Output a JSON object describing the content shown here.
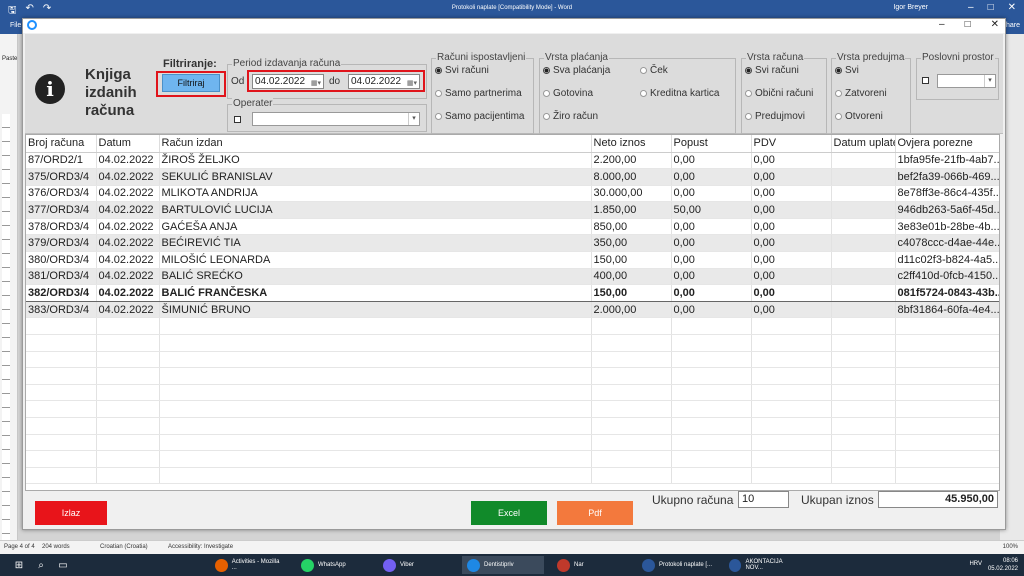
{
  "word": {
    "title": "Protokoli naplate [Compatibility Mode] - Word",
    "user": "Igor Breyer",
    "file_tab": "File",
    "share": "Share",
    "paste": "Paste",
    "status": {
      "page": "Page 4 of 4",
      "words": "204 words",
      "language": "Croatian (Croatia)",
      "accessibility": "Accessibility: Investigate",
      "zoom": "100%"
    }
  },
  "taskbar": {
    "apps": [
      {
        "label": "Activities - Mozilla ...",
        "color": "#e66000"
      },
      {
        "label": "WhatsApp",
        "color": "#25d366"
      },
      {
        "label": "Viber",
        "color": "#7360f2"
      },
      {
        "label": "Dentistipriv",
        "color": "#1e88e5"
      },
      {
        "label": "Nar",
        "color": "#c0392b"
      },
      {
        "label": "Protokoli naplate [...",
        "color": "#2b579a"
      },
      {
        "label": "AKONTACIJA NOV...",
        "color": "#2b579a"
      }
    ],
    "lang": "HRV",
    "time": "08:06",
    "date": "05.02.2022"
  },
  "header": {
    "title_lines": [
      "Knjiga",
      "izdanih",
      "računa"
    ],
    "filter_title": "Filtriranje:",
    "filter_button": "Filtriraj",
    "period": {
      "title": "Period izdavanja računa",
      "from_label": "Od",
      "from": "04.02.2022",
      "to_label": "do",
      "to": "04.02.2022"
    },
    "operator": {
      "title": "Operater",
      "value": ""
    },
    "racuni": {
      "title": "Računi ispostavljeni",
      "options": [
        "Svi računi",
        "Samo partnerima",
        "Samo pacijentima"
      ],
      "selected": 0
    },
    "placanje": {
      "title": "Vrsta plaćanja",
      "options": [
        "Sva plaćanja",
        "Gotovina",
        "Žiro račun",
        "Ček",
        "Kreditna kartica"
      ],
      "selected": 0
    },
    "vrsta_racuna": {
      "title": "Vrsta računa",
      "options": [
        "Svi računi",
        "Obični računi",
        "Predujmovi"
      ],
      "selected": 0
    },
    "vrsta_predujma": {
      "title": "Vrsta predujma",
      "options": [
        "Svi",
        "Zatvoreni",
        "Otvoreni"
      ],
      "selected": 0
    },
    "poslovni_prostor": {
      "title": "Poslovni prostor",
      "value": ""
    }
  },
  "table": {
    "columns": [
      "Broj računa",
      "Datum",
      "Račun izdan",
      "Neto iznos",
      "Popust",
      "PDV",
      "Datum uplate",
      "Ovjera porezne"
    ],
    "rows": [
      [
        "87/ORD2/1",
        "04.02.2022",
        "ŽIROŠ ŽELJKO",
        "2.200,00",
        "0,00",
        "0,00",
        "",
        "1bfa95fe-21fb-4ab7..."
      ],
      [
        "375/ORD3/4",
        "04.02.2022",
        "SEKULIĆ BRANISLAV",
        "8.000,00",
        "0,00",
        "0,00",
        "",
        "bef2fa39-066b-469..."
      ],
      [
        "376/ORD3/4",
        "04.02.2022",
        "MLIKOTA ANDRIJA",
        "30.000,00",
        "0,00",
        "0,00",
        "",
        "8e78ff3e-86c4-435f..."
      ],
      [
        "377/ORD3/4",
        "04.02.2022",
        "BARTULOVIĆ LUCIJA",
        "1.850,00",
        "50,00",
        "0,00",
        "",
        "946db263-5a6f-45d..."
      ],
      [
        "378/ORD3/4",
        "04.02.2022",
        "GAĆEŠA ANJA",
        "850,00",
        "0,00",
        "0,00",
        "",
        "3e83e01b-28be-4b..."
      ],
      [
        "379/ORD3/4",
        "04.02.2022",
        "BEĆIREVIĆ TIA",
        "350,00",
        "0,00",
        "0,00",
        "",
        "c4078ccc-d4ae-44e..."
      ],
      [
        "380/ORD3/4",
        "04.02.2022",
        "MILOŠIĆ LEONARDA",
        "150,00",
        "0,00",
        "0,00",
        "",
        "d11c02f3-b824-4a5..."
      ],
      [
        "381/ORD3/4",
        "04.02.2022",
        "BALIĆ SREĆKO",
        "400,00",
        "0,00",
        "0,00",
        "",
        "c2ff410d-0fcb-4150..."
      ],
      [
        "382/ORD3/4",
        "04.02.2022",
        "BALIĆ FRANČESKA",
        "150,00",
        "0,00",
        "0,00",
        "",
        "081f5724-0843-43b..."
      ],
      [
        "383/ORD3/4",
        "04.02.2022",
        "ŠIMUNIĆ BRUNO",
        "2.000,00",
        "0,00",
        "0,00",
        "",
        "8bf31864-60fa-4e4..."
      ]
    ],
    "selected_row": 8
  },
  "footer": {
    "exit": "Izlaz",
    "excel": "Excel",
    "pdf": "Pdf",
    "count_label": "Ukupno računa",
    "count": "10",
    "total_label": "Ukupan iznos",
    "total": "45.950,00"
  },
  "colors": {
    "exit": "#e8141a",
    "excel": "#118a2a",
    "pdf": "#f3793d",
    "filter_btn": "#6fb5ef",
    "highlight": "#e0141b"
  }
}
